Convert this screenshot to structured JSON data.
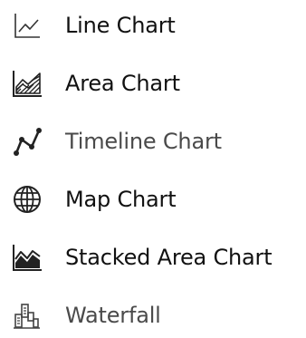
{
  "menu": {
    "items": [
      {
        "label": "Line Chart",
        "icon": "line-chart-icon"
      },
      {
        "label": "Area Chart",
        "icon": "area-chart-icon"
      },
      {
        "label": "Timeline Chart",
        "icon": "timeline-chart-icon"
      },
      {
        "label": "Map Chart",
        "icon": "globe-icon"
      },
      {
        "label": "Stacked Area Chart",
        "icon": "stacked-area-chart-icon"
      },
      {
        "label": "Waterfall",
        "icon": "waterfall-chart-icon"
      }
    ]
  }
}
